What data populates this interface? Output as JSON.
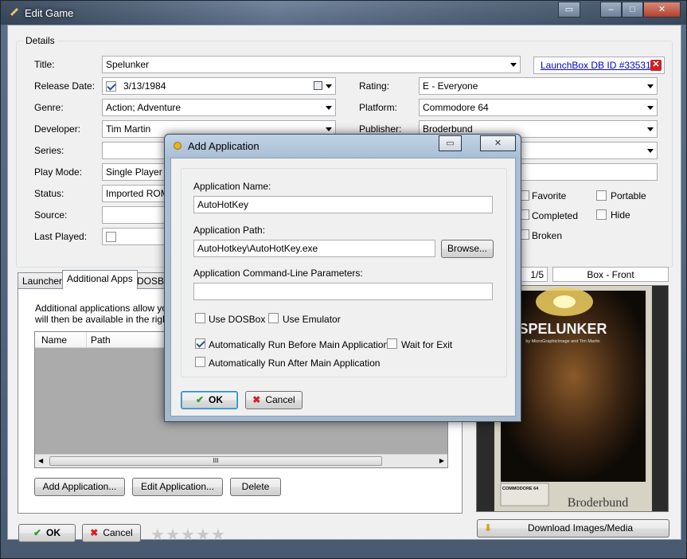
{
  "window": {
    "title": "Edit Game"
  },
  "details": {
    "legend": "Details",
    "labels": {
      "title": "Title:",
      "release_date": "Release Date:",
      "genre": "Genre:",
      "developer": "Developer:",
      "series": "Series:",
      "play_mode": "Play Mode:",
      "status": "Status:",
      "source": "Source:",
      "last_played": "Last Played:",
      "rating": "Rating:",
      "platform": "Platform:",
      "publisher": "Publisher:"
    },
    "title_value": "Spelunker",
    "launchbox_link": "LaunchBox DB ID #33531",
    "release_date_value": "3/13/1984",
    "genre_value": "Action; Adventure",
    "developer_value": "Tim Martin",
    "play_mode_value": "Single Player",
    "status_value": "Imported ROM",
    "rating_value": "E - Everyone",
    "platform_value": "Commodore 64",
    "publisher_value": "Broderbund",
    "flags": {
      "favorite": "Favorite",
      "portable": "Portable",
      "completed": "Completed",
      "hide": "Hide",
      "broken": "Broken"
    }
  },
  "tabs": [
    "Launcher",
    "Additional Apps",
    "DOSBox"
  ],
  "additional_apps": {
    "description_line1": "Additional applications allow you to",
    "description_line2": "will then be available in the right-c",
    "columns": [
      "Name",
      "Path"
    ],
    "scroll_thumb": "III",
    "add_button": "Add Application...",
    "edit_button": "Edit Application...",
    "delete_button": "Delete"
  },
  "media": {
    "page_indicator": "1/5",
    "image_type": "Box - Front",
    "download_button": "Download Images/Media"
  },
  "boxart": {
    "title": "SPELUNKER",
    "byline": "by MicroGraphicImage and Tim Martin",
    "platform_tag": "COMMODORE 64",
    "publisher": "Broderbund"
  },
  "footer": {
    "ok": "OK",
    "cancel": "Cancel",
    "rating_stars": 0,
    "stars_total": 5
  },
  "dialog": {
    "title": "Add Application",
    "name_label": "Application Name:",
    "name_value": "AutoHotKey",
    "path_label": "Application Path:",
    "path_value": "AutoHotkey\\AutoHotKey.exe",
    "browse_button": "Browse...",
    "params_label": "Application Command-Line Parameters:",
    "params_value": "",
    "use_dosbox": "Use DOSBox",
    "use_emulator": "Use Emulator",
    "run_before": "Automatically Run Before Main Application",
    "wait_for_exit": "Wait for Exit",
    "run_after": "Automatically Run After Main Application",
    "ok": "OK",
    "cancel": "Cancel"
  }
}
